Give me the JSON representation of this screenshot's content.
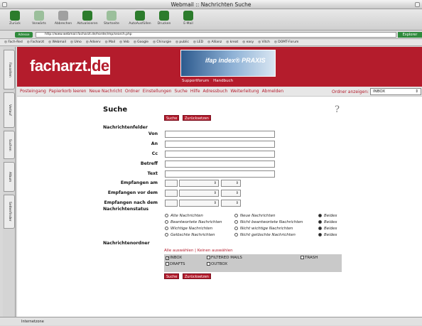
{
  "window": {
    "title": "Webmail :: Nachrichten Suche"
  },
  "toolbar": [
    {
      "label": "Zurück",
      "icon": "back-arrow-icon",
      "color": "#2c7c2c"
    },
    {
      "label": "Vorwärts",
      "icon": "forward-arrow-icon",
      "color": "#9bbf9b"
    },
    {
      "label": "Abbrechen",
      "icon": "stop-icon",
      "color": "#a0a0a0"
    },
    {
      "label": "Aktualisieren",
      "icon": "refresh-icon",
      "color": "#2c7c2c"
    },
    {
      "label": "Startseite",
      "icon": "home-icon",
      "color": "#9bbf9b"
    },
    {
      "label": "AutoAusfüllen",
      "icon": "autofill-icon",
      "color": "#2c7c2c"
    },
    {
      "label": "Drucken",
      "icon": "print-icon",
      "color": "#2c7c2c"
    },
    {
      "label": "E-Mail",
      "icon": "mail-icon",
      "color": "#2c7c2c"
    }
  ],
  "address": {
    "button": "Adresse",
    "url": "http://www.webmail.facharzt.de/horde/imp/search.php",
    "go": "Explorer"
  },
  "favorites": [
    "Fach-Red",
    "Facharzt",
    "Webmail",
    "Umo",
    "Adserv",
    "Mail",
    "Veb",
    "Google",
    "Chirurgie",
    "public",
    "LED",
    "Allianz",
    "kreat",
    "easy",
    "Vitch",
    "DOMT-Forum"
  ],
  "sidetabs": [
    "Favoriten",
    "Verlauf",
    "Suchen",
    "Album",
    "Seitenfinder"
  ],
  "header": {
    "logo_main": "facharzt.",
    "logo_tld": "de",
    "banner": "ifap index® PRAXIS",
    "sublinks": [
      "Supportforum",
      "Handbuch"
    ]
  },
  "nav": {
    "items": [
      "Posteingang",
      "Papierkorb leeren",
      "Neue Nachricht",
      "Ordner",
      "Einstellungen",
      "Suche",
      "Hilfe",
      "Adressbuch",
      "Weiterleitung",
      "Abmelden"
    ],
    "folder_label": "Ordner anzeigen:",
    "folder_value": "INBOX"
  },
  "search": {
    "title": "Suche",
    "help": "?",
    "btn_search": "Suche",
    "btn_reset": "Zurücksetzen",
    "section_fields": "Nachrichtenfelder",
    "fields": [
      "Von",
      "An",
      "Cc",
      "Betreff",
      "Text"
    ],
    "dates": [
      "Empfangen am",
      "Empfangen vor dem",
      "Empfangen nach dem"
    ],
    "section_status": "Nachrichtenstatus",
    "status_rows": [
      [
        "Alte Nachrichten",
        "Neue Nachrichten",
        "Beides"
      ],
      [
        "Beantwortete Nachrichten",
        "Nicht beantwortete Nachrichten",
        "Beides"
      ],
      [
        "Wichtige Nachrichten",
        "Nicht wichtige Nachrichten",
        "Beides"
      ],
      [
        "Gelöschte Nachrichten",
        "Nicht gelöschte Nachrichten",
        "Beides"
      ]
    ],
    "section_folders": "Nachrichtenordner",
    "select_all": "Alle auswählen | Keinen auswählen",
    "folders": [
      "INBOX",
      "FILTERED MAILS",
      "TRASH",
      "DRAFTS",
      "OUTBOX"
    ]
  },
  "status": {
    "text": "Internetzone"
  }
}
